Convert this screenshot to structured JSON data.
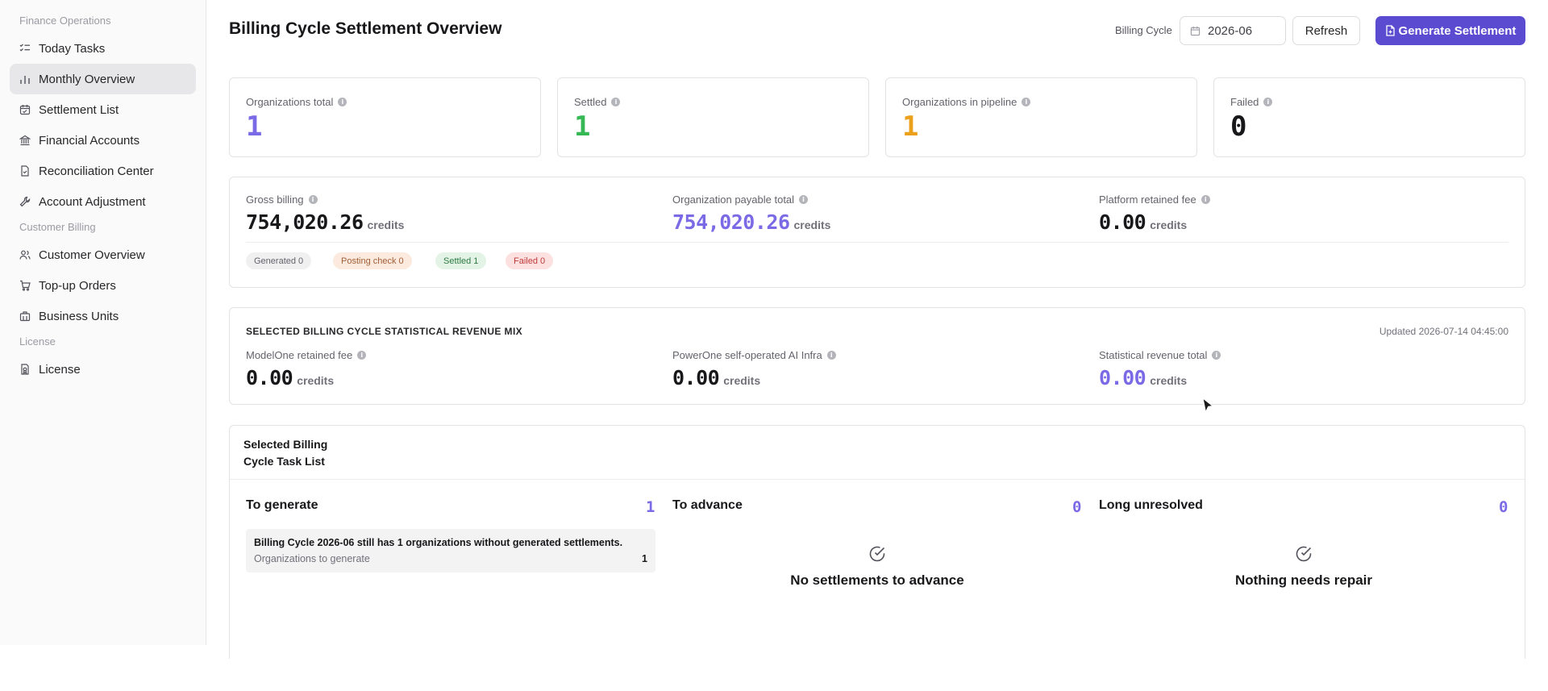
{
  "sidebar": {
    "groups": [
      {
        "title": "Finance Operations",
        "items": [
          {
            "label": "Today Tasks",
            "icon": "task-list-icon"
          },
          {
            "label": "Monthly Overview",
            "icon": "bar-chart-icon",
            "active": true
          },
          {
            "label": "Settlement List",
            "icon": "calendar-check-icon"
          },
          {
            "label": "Financial Accounts",
            "icon": "bank-icon"
          },
          {
            "label": "Reconciliation Center",
            "icon": "document-check-icon"
          },
          {
            "label": "Account Adjustment",
            "icon": "wrench-icon"
          }
        ]
      },
      {
        "title": "Customer Billing",
        "items": [
          {
            "label": "Customer Overview",
            "icon": "users-icon"
          },
          {
            "label": "Top-up Orders",
            "icon": "cart-icon"
          },
          {
            "label": "Business Units",
            "icon": "building-icon"
          }
        ]
      },
      {
        "title": "License",
        "items": [
          {
            "label": "License",
            "icon": "license-icon"
          }
        ]
      }
    ]
  },
  "header": {
    "title": "Billing Cycle Settlement Overview",
    "billing_cycle_label": "Billing Cycle",
    "billing_cycle_value": "2026-06",
    "refresh_label": "Refresh",
    "generate_label": "Generate Settlement"
  },
  "stats": [
    {
      "label": "Organizations total",
      "value": "1",
      "color": "#7b6ae6"
    },
    {
      "label": "Settled",
      "value": "1",
      "color": "#36b955"
    },
    {
      "label": "Organizations in pipeline",
      "value": "1",
      "color": "#eca11c"
    },
    {
      "label": "Failed",
      "value": "0",
      "color": "#18181b"
    }
  ],
  "billing": {
    "gross_label": "Gross billing",
    "gross_value": "754,020.26",
    "payable_label": "Organization payable total",
    "payable_value": "754,020.26",
    "retained_label": "Platform retained fee",
    "retained_value": "0.00",
    "unit": "credits",
    "chips": {
      "generated": "Generated 0",
      "posting": "Posting check 0",
      "settled": "Settled 1",
      "failed": "Failed 0"
    }
  },
  "revenue_mix": {
    "title": "SELECTED BILLING CYCLE STATISTICAL REVENUE MIX",
    "updated": "Updated 2026-07-14 04:45:00",
    "modelone_label": "ModelOne retained fee",
    "modelone_value": "0.00",
    "powerone_label": "PowerOne self-operated AI Infra",
    "powerone_value": "0.00",
    "total_label": "Statistical revenue total",
    "total_value": "0.00",
    "unit": "credits"
  },
  "tasks": {
    "title": "Selected Billing Cycle Task List",
    "to_generate": {
      "label": "To generate",
      "count": "1"
    },
    "to_advance": {
      "label": "To advance",
      "count": "0",
      "empty": "No settlements to advance"
    },
    "long_unresolved": {
      "label": "Long unresolved",
      "count": "0",
      "empty": "Nothing needs repair"
    },
    "row": {
      "text": "Billing Cycle 2026-06 still has 1 organizations without generated settlements.",
      "sub": "Organizations to generate",
      "count": "1"
    }
  },
  "colors": {
    "accent": "#5b4bd0",
    "purple_value": "#7b6ae6",
    "green_value": "#36b955",
    "amber_value": "#eca11c"
  }
}
